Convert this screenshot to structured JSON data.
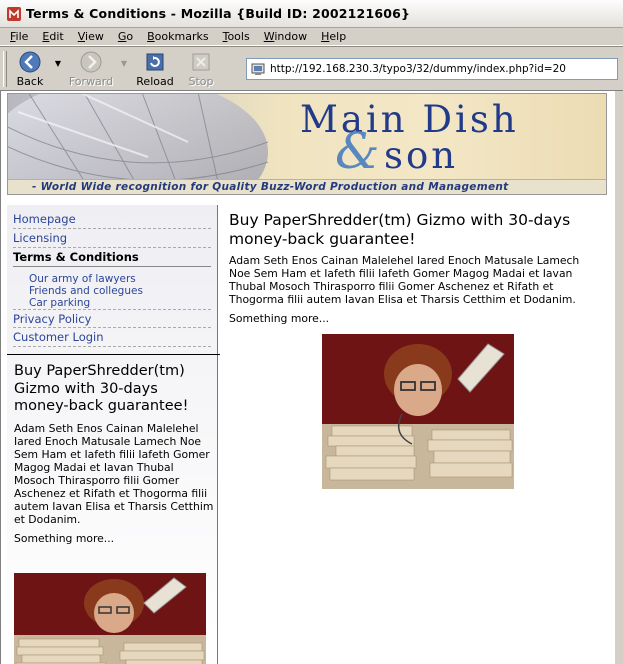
{
  "window": {
    "title": "Terms & Conditions - Mozilla {Build ID: 2002121606}"
  },
  "menubar": {
    "items": [
      {
        "u": "F",
        "rest": "ile"
      },
      {
        "u": "E",
        "rest": "dit"
      },
      {
        "u": "V",
        "rest": "iew"
      },
      {
        "u": "G",
        "rest": "o"
      },
      {
        "u": "B",
        "rest": "ookmarks"
      },
      {
        "u": "T",
        "rest": "ools"
      },
      {
        "u": "W",
        "rest": "indow"
      },
      {
        "u": "H",
        "rest": "elp"
      }
    ]
  },
  "toolbar": {
    "back_label": "Back",
    "forward_label": "Forward",
    "reload_label": "Reload",
    "stop_label": "Stop",
    "url": "http://192.168.230.3/typo3/32/dummy/index.php?id=20"
  },
  "banner": {
    "logo_line1": "Main Dish",
    "logo_amp": "&",
    "logo_line2": "son",
    "slogan": "- World Wide recognition for Quality Buzz-Word Production and Management"
  },
  "nav": {
    "items": [
      "Homepage",
      "Licensing",
      "Terms & Conditions"
    ],
    "sub_items": [
      "Our army of lawyers",
      "Friends and collegues",
      "Car parking"
    ],
    "items_after": [
      "Privacy Policy",
      "Customer Login"
    ]
  },
  "sidebar_box": {
    "title": "Buy PaperShredder(tm) Gizmo with 30-days money-back guarantee!",
    "body": "Adam Seth Enos Cainan Malelehel Iared Enoch Matusale Lamech Noe Sem Ham et Iafeth filii Iafeth Gomer Magog Madai et Iavan Thubal Mosoch Thirasporro filii Gomer Aschenez et Rifath et Thogorma filii autem Iavan Elisa et Tharsis Cetthim et Dodanim.",
    "more": "Something more..."
  },
  "main": {
    "title": "Buy PaperShredder(tm) Gizmo with 30-days money-back guarantee!",
    "body": "Adam Seth Enos Cainan Malelehel Iared Enoch Matusale Lamech Noe Sem Ham et Iafeth filii Iafeth Gomer Magog Madai et Iavan Thubal Mosoch Thirasporro filii Gomer Aschenez et Rifath et Thogorma filii autem Iavan Elisa et Tharsis Cetthim et Dodanim.",
    "more": "Something more..."
  },
  "colors": {
    "link": "#2b4599",
    "logo": "#213a8a",
    "photo_bg": "#6e1414"
  }
}
